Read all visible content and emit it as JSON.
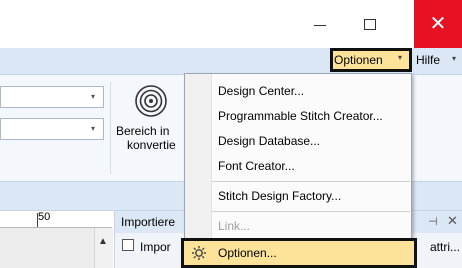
{
  "title_bar": {
    "window_title": "",
    "close_glyph": "✕"
  },
  "menu_bar": {
    "optionen_label": "Optionen",
    "optionen_arrow": "▾",
    "hilfe_label": "Hilfe",
    "hilfe_arrow": "▾"
  },
  "ribbon": {
    "combo_arrow": "▾",
    "convert_button": {
      "line1": "Bereich in",
      "line2": "konvertie"
    }
  },
  "ruler": {
    "mark_label": "50"
  },
  "import_panel": {
    "title": "Importiere",
    "pin_glyph": "⊣",
    "close_glyph": "✕",
    "row_label": "Impor",
    "row_right_label": "attri..."
  },
  "options_menu": {
    "items": [
      {
        "label": "Design Center..."
      },
      {
        "label": "Programmable Stitch Creator..."
      },
      {
        "label": "Design Database..."
      },
      {
        "label": "Font Creator..."
      },
      {
        "label": "Stitch Design Factory..."
      },
      {
        "label": "Link..."
      }
    ],
    "highlighted_item": "Optionen..."
  },
  "colors": {
    "highlight": "#fde39a",
    "close_button": "#e81123",
    "menu_bar": "#dbe7f4"
  }
}
